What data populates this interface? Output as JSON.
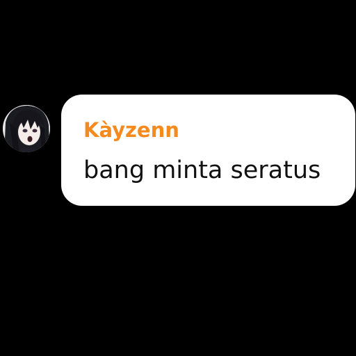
{
  "message": {
    "sender_name": "Kàyzenn",
    "text": "bang minta seratus"
  },
  "colors": {
    "background": "#000000",
    "bubble": "#ffffff",
    "sender_name": "#f58a1f",
    "message_text": "#111111"
  },
  "avatar": {
    "icon": "anime-girl-avatar-icon"
  }
}
